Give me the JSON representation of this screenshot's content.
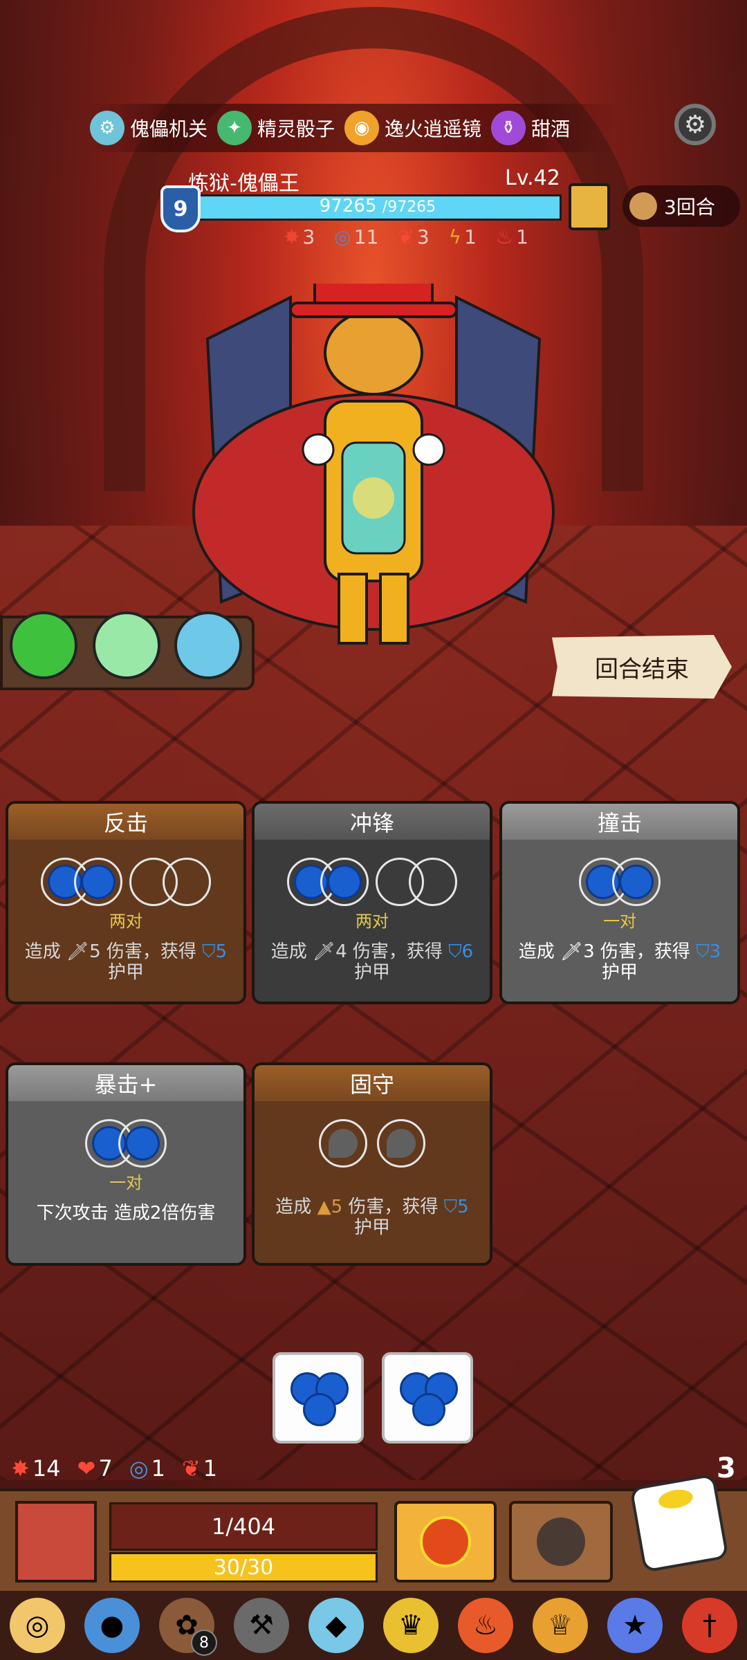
{
  "relics": [
    {
      "icon": "puppet-mechanism-icon",
      "label": "傀儡机关",
      "color": "#6ec4d8"
    },
    {
      "icon": "spirit-dice-icon",
      "label": "精灵骰子",
      "color": "#46b870"
    },
    {
      "icon": "fire-mirror-icon",
      "label": "逸火逍遥镜",
      "color": "#f0a22a"
    },
    {
      "icon": "sweet-wine-icon",
      "label": "甜酒",
      "color": "#a24ad8"
    }
  ],
  "boss": {
    "name": "炼狱-傀儡王",
    "level": "Lv.42",
    "shield": "9",
    "hp_current": "97265",
    "hp_max": "/97265",
    "hp_fraction": 1.0,
    "status": [
      {
        "icon": "strength-icon",
        "value": "3"
      },
      {
        "icon": "focus-icon",
        "value": "11"
      },
      {
        "icon": "burn-icon",
        "value": "3"
      },
      {
        "icon": "lightning-icon",
        "value": "1"
      },
      {
        "icon": "flame-icon",
        "value": "1"
      }
    ]
  },
  "round": {
    "label": "3回合"
  },
  "end_turn": {
    "label": "回合结束"
  },
  "cards": [
    {
      "title": "反击",
      "requirement": "两对",
      "desc_pre": "造成",
      "desc_a": "5",
      "desc_mid": "伤害，获得",
      "desc_b": "5",
      "desc_post": "护甲"
    },
    {
      "title": "冲锋",
      "requirement": "两对",
      "desc_pre": "造成",
      "desc_a": "4",
      "desc_mid": "伤害，获得",
      "desc_b": "6",
      "desc_post": "护甲"
    },
    {
      "title": "撞击",
      "requirement": "一对",
      "desc_pre": "造成",
      "desc_a": "3",
      "desc_mid": "伤害，获得",
      "desc_b": "3",
      "desc_post": "护甲"
    },
    {
      "title": "暴击+",
      "requirement": "一对",
      "desc": "下次攻击 造成2倍伤害"
    },
    {
      "title": "固守",
      "requirement": "",
      "desc_pre": "造成",
      "desc_a": "5",
      "desc_mid": "伤害，获得",
      "desc_b": "5",
      "desc_post": "护甲"
    }
  ],
  "player_status": [
    {
      "icon": "strength-icon",
      "value": "14",
      "color": "#ff4a3a"
    },
    {
      "icon": "heart-icon",
      "value": "7",
      "color": "#ff4a3a"
    },
    {
      "icon": "focus-icon",
      "value": "1",
      "color": "#3a9ae8"
    },
    {
      "icon": "rage-icon",
      "value": "1",
      "color": "#ff4a3a"
    }
  ],
  "hand_count": "3",
  "player": {
    "hp": "1/404",
    "energy": "30/30"
  },
  "items": [
    {
      "icon": "shield-disc-icon"
    },
    {
      "icon": "blue-egg-icon"
    },
    {
      "icon": "button-icon",
      "badge": "8"
    },
    {
      "icon": "axe-icon"
    },
    {
      "icon": "crystal-icon"
    },
    {
      "icon": "crown-icon"
    },
    {
      "icon": "fire-boot-icon"
    },
    {
      "icon": "trophy-icon"
    },
    {
      "icon": "crystal-ball-icon"
    },
    {
      "icon": "dagger-icon"
    }
  ]
}
